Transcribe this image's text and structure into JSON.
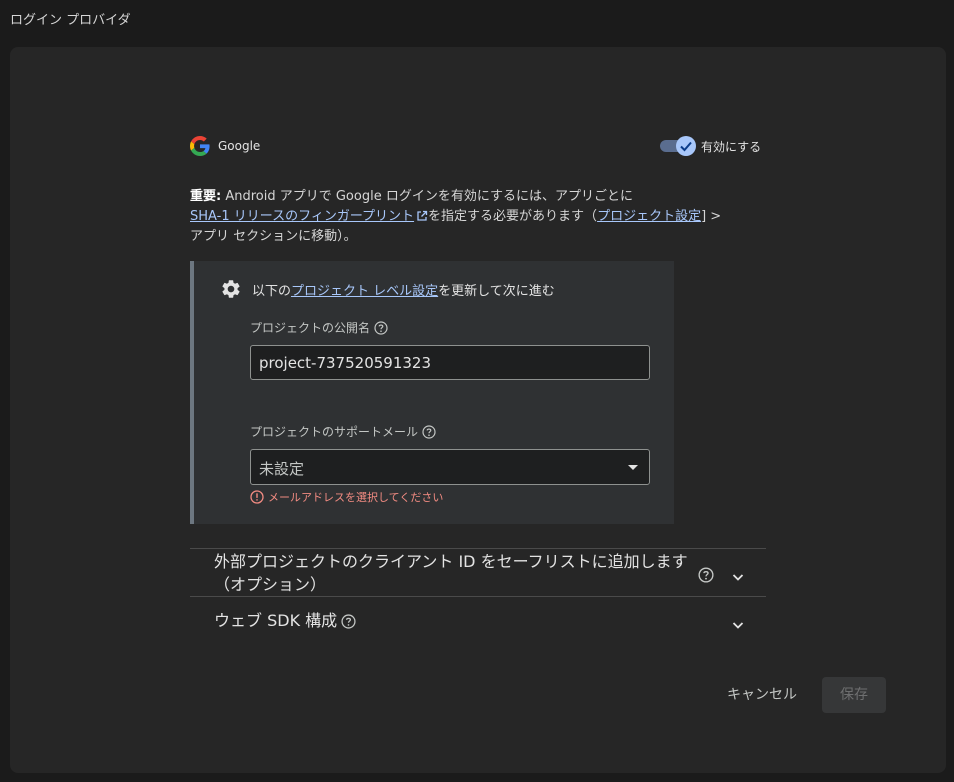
{
  "page": {
    "title": "ログイン プロバイダ"
  },
  "provider": {
    "name": "Google",
    "enabled": true,
    "toggle_label": "有効にする"
  },
  "notice": {
    "bold": "重要:",
    "text_1": " Android アプリで Google ログインを有効にするには、アプリごとに",
    "link_sha": "SHA-1 リリースのフィンガープリント",
    "text_2": "を指定する必要があります（",
    "link_settings": "プロジェクト設定",
    "text_3": "] >",
    "text_4": "アプリ セクションに移動）。"
  },
  "settings": {
    "head_prefix": "以下の",
    "head_link": "プロジェクト レベル設定",
    "head_suffix": "を更新して次に進む",
    "public_name_label": "プロジェクトの公開名",
    "public_name_value": "project-737520591323",
    "support_email_label": "プロジェクトのサポートメール",
    "support_email_value": "未設定",
    "error_text": "メールアドレスを選択してください"
  },
  "accordions": [
    {
      "line1": "外部プロジェクトのクライアント ID をセーフリストに追加します",
      "line2": "（オプション）"
    },
    {
      "title": "ウェブ SDK 構成"
    }
  ],
  "actions": {
    "cancel_label": "キャンセル",
    "save_label": "保存"
  },
  "colors": {
    "accent": "#a8c7fa",
    "error": "#f28b82",
    "card_bg": "#262626",
    "page_bg": "#1b1b1b"
  }
}
